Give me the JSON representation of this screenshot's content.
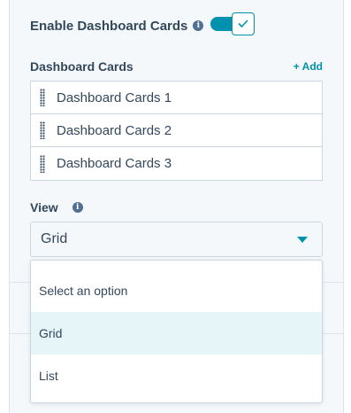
{
  "settings": {
    "enable_cards": {
      "label": "Enable Dashboard Cards",
      "info_icon": "info-icon",
      "enabled": true,
      "toggle_icon": "checkmark-icon"
    },
    "cards_section": {
      "title": "Dashboard Cards",
      "add_label": "+ Add",
      "items": [
        {
          "label": "Dashboard Cards 1",
          "handle_icon": "drag-handle-icon"
        },
        {
          "label": "Dashboard Cards 2",
          "handle_icon": "drag-handle-icon"
        },
        {
          "label": "Dashboard Cards 3",
          "handle_icon": "drag-handle-icon"
        }
      ]
    },
    "view": {
      "label": "View",
      "info_icon": "info-icon",
      "selected_value": "Grid",
      "caret_icon": "caret-down-icon",
      "options": [
        {
          "label": "Select an option",
          "selected": false
        },
        {
          "label": "Grid",
          "selected": true
        },
        {
          "label": "List",
          "selected": false
        }
      ]
    }
  },
  "colors": {
    "accent": "#0091ae",
    "text": "#33475b",
    "border": "#cbd6e2",
    "panel_bg": "#f5f8fa",
    "selected_option_bg": "#e5f5f8"
  }
}
